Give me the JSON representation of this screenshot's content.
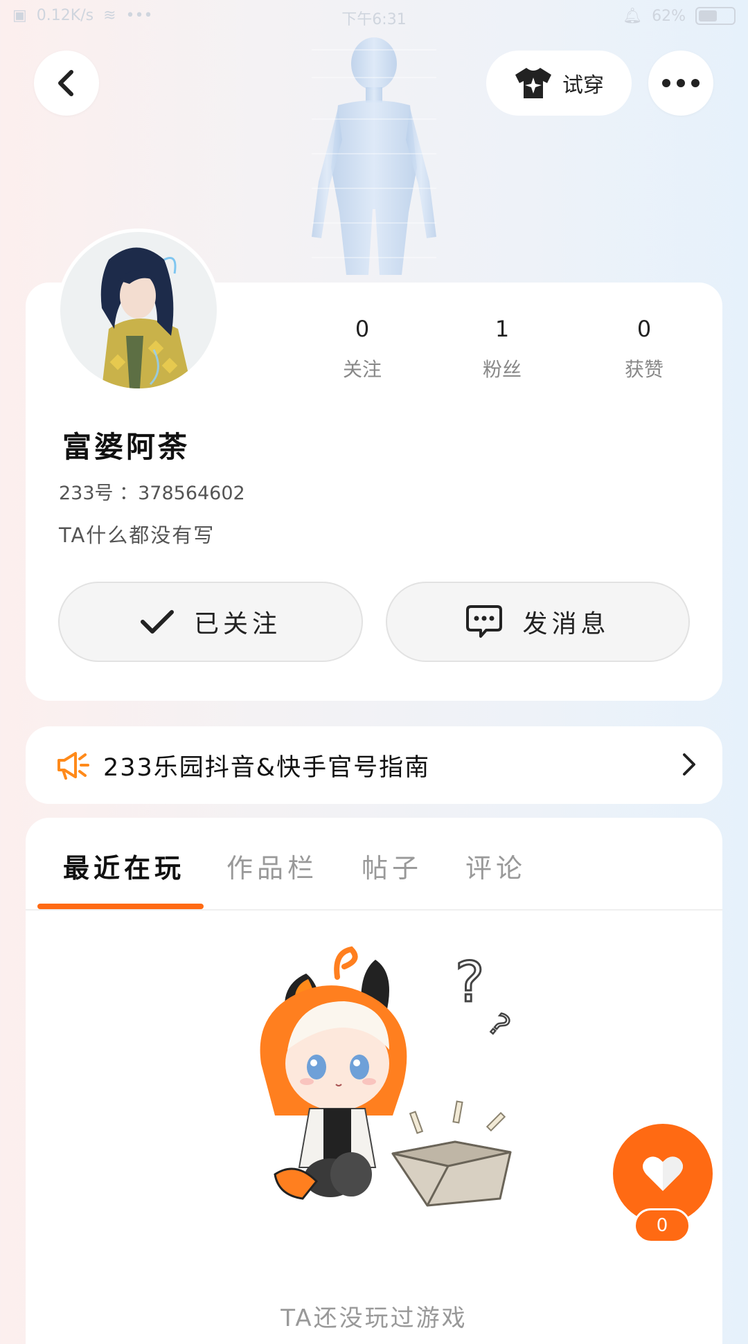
{
  "status_bar": {
    "time": "下午6:31",
    "network_speed": "0.12K/s",
    "battery": "62%"
  },
  "header": {
    "try_on_label": "试穿",
    "icons": [
      "back-arrow-icon",
      "tshirt-icon",
      "more-dots-icon"
    ]
  },
  "profile": {
    "stats": [
      {
        "value": "0",
        "label": "关注"
      },
      {
        "value": "1",
        "label": "粉丝"
      },
      {
        "value": "0",
        "label": "获赞"
      }
    ],
    "name": "富婆阿荼",
    "uid": "233号 ：378564602",
    "bio": "TA什么都没有写",
    "follow_label": "已关注",
    "message_label": "发消息"
  },
  "notice": {
    "text": "233乐园抖音&快手官号指南"
  },
  "tabs": [
    {
      "label": "最近在玩",
      "active": true
    },
    {
      "label": "作品栏",
      "active": false
    },
    {
      "label": "帖子",
      "active": false
    },
    {
      "label": "评论",
      "active": false
    }
  ],
  "empty_state": {
    "text": "TA还没玩过游戏"
  },
  "like": {
    "count": "0"
  },
  "colors": {
    "accent": "#ff6a13",
    "card": "#ffffff",
    "muted_text": "#999999"
  }
}
